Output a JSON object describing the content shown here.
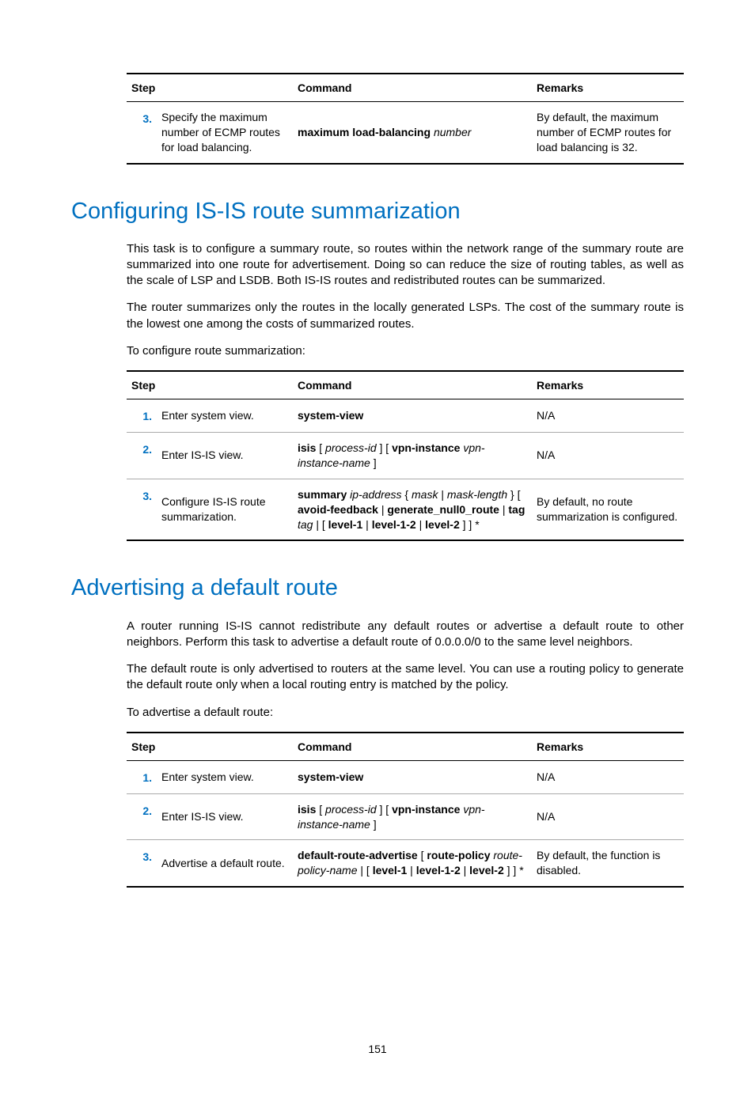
{
  "page_number": "151",
  "t1": {
    "headers": {
      "step": "Step",
      "command": "Command",
      "remarks": "Remarks"
    },
    "rows": [
      {
        "n": "3.",
        "desc": "Specify the maximum number of ECMP routes for load balancing.",
        "cmd": {
          "p1b": "maximum load-balancing ",
          "p2i": "number"
        },
        "rem": "By default, the maximum number of ECMP routes for load balancing is 32."
      }
    ]
  },
  "s2_heading": "Configuring IS-IS route summarization",
  "s2_p1": "This task is to configure a summary route, so routes within the network range of the summary route are summarized into one route for advertisement. Doing so can reduce the size of routing tables, as well as the scale of LSP and LSDB. Both IS-IS routes and redistributed routes can be summarized.",
  "s2_p2": "The router summarizes only the routes in the locally generated LSPs. The cost of the summary route is the lowest one among the costs of summarized routes.",
  "s2_p3": "To configure route summarization:",
  "t2": {
    "headers": {
      "step": "Step",
      "command": "Command",
      "remarks": "Remarks"
    },
    "rows": [
      {
        "n": "1.",
        "desc": "Enter system view.",
        "cmd": {
          "p1b": "system-view"
        },
        "rem": "N/A"
      },
      {
        "n": "2.",
        "desc": "Enter IS-IS view.",
        "cmd": {
          "p1b": "isis ",
          "p2": "[ ",
          "p3i": "process-id ",
          "p4": "] [ ",
          "p5b": "vpn-instance ",
          "p6i": "vpn-instance-name ",
          "p7": "]"
        },
        "rem": "N/A"
      },
      {
        "n": "3.",
        "desc": "Configure IS-IS route summarization.",
        "cmd": {
          "p1b": "summary ",
          "p2i": "ip-address ",
          "p3": "{ ",
          "p4i": "mask",
          "p5": " | ",
          "p6i": "mask-length",
          "p7": " } [ ",
          "p8b": "avoid-feedback",
          "p9": " | ",
          "p10b": "generate_null0_route",
          "p11": " | ",
          "p12b": "tag ",
          "p13i": "tag",
          "p14": " | [ ",
          "p15b": "level-1",
          "p16": " | ",
          "p17b": "level-1-2",
          "p18": " | ",
          "p19b": "level-2",
          "p20": " ] ] *"
        },
        "rem": "By default, no route summarization is configured."
      }
    ]
  },
  "s3_heading": "Advertising a default route",
  "s3_p1": "A router running IS-IS cannot redistribute any default routes or advertise a default route to other neighbors. Perform this task to advertise a default route of 0.0.0.0/0 to the same level neighbors.",
  "s3_p2": "The default route is only advertised to routers at the same level. You can use a routing policy to generate the default route only when a local routing entry is matched by the policy.",
  "s3_p3": "To advertise a default route:",
  "t3": {
    "headers": {
      "step": "Step",
      "command": "Command",
      "remarks": "Remarks"
    },
    "rows": [
      {
        "n": "1.",
        "desc": "Enter system view.",
        "cmd": {
          "p1b": "system-view"
        },
        "rem": "N/A"
      },
      {
        "n": "2.",
        "desc": "Enter IS-IS view.",
        "cmd": {
          "p1b": "isis ",
          "p2": "[ ",
          "p3i": "process-id ",
          "p4": "] [ ",
          "p5b": "vpn-instance ",
          "p6i": "vpn-instance-name ",
          "p7": "]"
        },
        "rem": "N/A"
      },
      {
        "n": "3.",
        "desc": "Advertise a default route.",
        "cmd": {
          "p1b": "default-route-advertise ",
          "p2": "[ ",
          "p3b": "route-policy ",
          "p4i": "route-policy-name",
          "p5": " | [ ",
          "p6b": "level-1",
          "p7": " | ",
          "p8b": "level-1-2",
          "p9": " | ",
          "p10b": "level-2",
          "p11": " ] ] *"
        },
        "rem": "By default, the function is disabled."
      }
    ]
  }
}
